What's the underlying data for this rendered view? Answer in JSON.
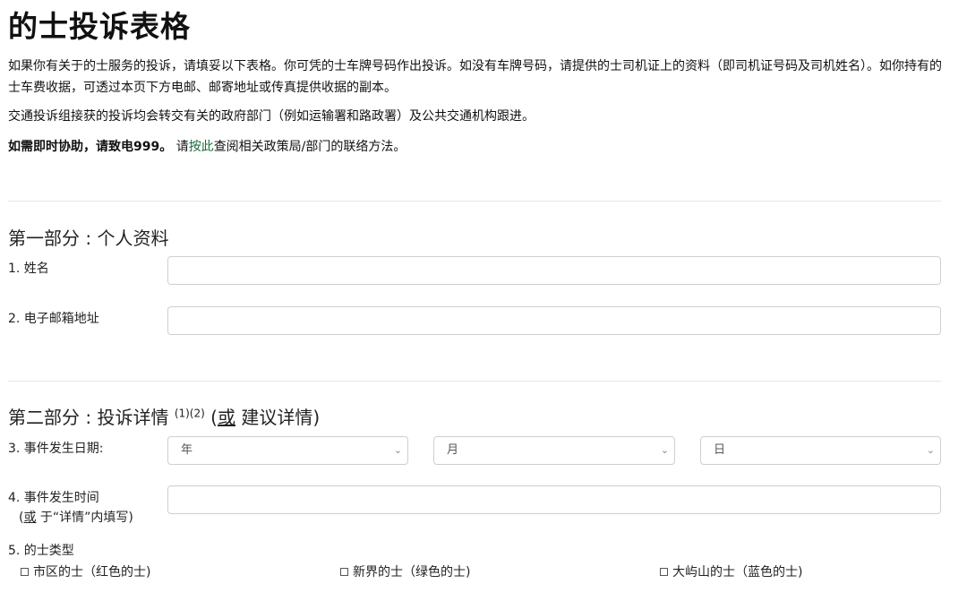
{
  "page": {
    "title": "的士投诉表格",
    "intro": "如果你有关于的士服务的投诉，请填妥以下表格。你可凭的士车牌号码作出投诉。如没有车牌号码，请提供的士司机证上的资料（即司机证号码及司机姓名）。如你持有的士车费收据，可透过本页下方电邮、邮寄地址或传真提供收据的副本。",
    "forward_note": "交通投诉组接获的投诉均会转交有关的政府部门（例如运输署和路政署）及公共交通机构跟进。",
    "urgent_bold": "如需即时协助，请致电999。",
    "urgent_pre": "请",
    "urgent_link": "按此",
    "urgent_post": "查阅相关政策局/部门的联络方法。"
  },
  "section1": {
    "title": "第一部分 : 个人资料",
    "name_label": "1. 姓名",
    "email_label": "2. 电子邮箱地址",
    "name_value": "",
    "email_value": ""
  },
  "section2": {
    "title_main": "第二部分 : 投诉详情",
    "title_sup": "(1)(2)",
    "title_paren_open": "(",
    "title_or": "或",
    "title_rest": " 建议详情)",
    "date_label": "3. 事件发生日期:",
    "year_placeholder": "年",
    "month_placeholder": "月",
    "day_placeholder": "日",
    "time_label_line1": "4. 事件发生时间",
    "time_label_or": "或",
    "time_label_line2": " 于“详情”内填写)",
    "time_label_paren": "(",
    "time_value": "",
    "taxi_type_label": "5. 的士类型",
    "taxi_types": [
      "市区的士（红色的士)",
      "新界的士（绿色的士)",
      "大屿山的士（蓝色的士)"
    ]
  },
  "colors": {
    "link": "#1a6b3a",
    "border": "#cfcfcf",
    "divider": "#e6e6e6"
  }
}
